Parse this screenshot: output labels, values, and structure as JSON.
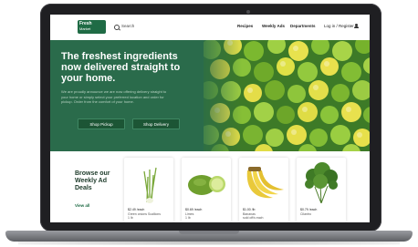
{
  "nav": {
    "logo_line1": "Fresh",
    "logo_line2": "Market",
    "search_label": "Search",
    "links": [
      "Recipes",
      "Weekly Ads",
      "Departments"
    ],
    "account_label": "Log in / Register"
  },
  "hero": {
    "title": "The freshest ingredients now delivered straight to your home.",
    "body": "We are proudly announce we are now offering delivery straight to your home or simply select your preferred location and order for pickup. Order from the comfort of your home.",
    "buttons": [
      "Shop Pickup",
      "Shop Delivery"
    ]
  },
  "deals": {
    "title": "Browse our Weekly Ad Deals",
    "view_all": "View all",
    "products": [
      {
        "price": "$2.49 /each",
        "name": "Green onions Scallions",
        "detail": "1 lb",
        "icon": "green-onion-icon"
      },
      {
        "price": "$0.69 /each",
        "name": "Limes",
        "detail": "1 lb",
        "icon": "lime-icon"
      },
      {
        "price": "$1.00 /lb",
        "name": "Bananas",
        "detail": "sold off/s each",
        "icon": "banana-icon"
      },
      {
        "price": "$0.79 /each",
        "name": "Cilantro",
        "detail": "",
        "icon": "cilantro-icon"
      }
    ]
  },
  "colors": {
    "brand_green": "#1f6b45",
    "hero_green": "#2a6b4b",
    "laptop_frame": "#1f1f22"
  }
}
